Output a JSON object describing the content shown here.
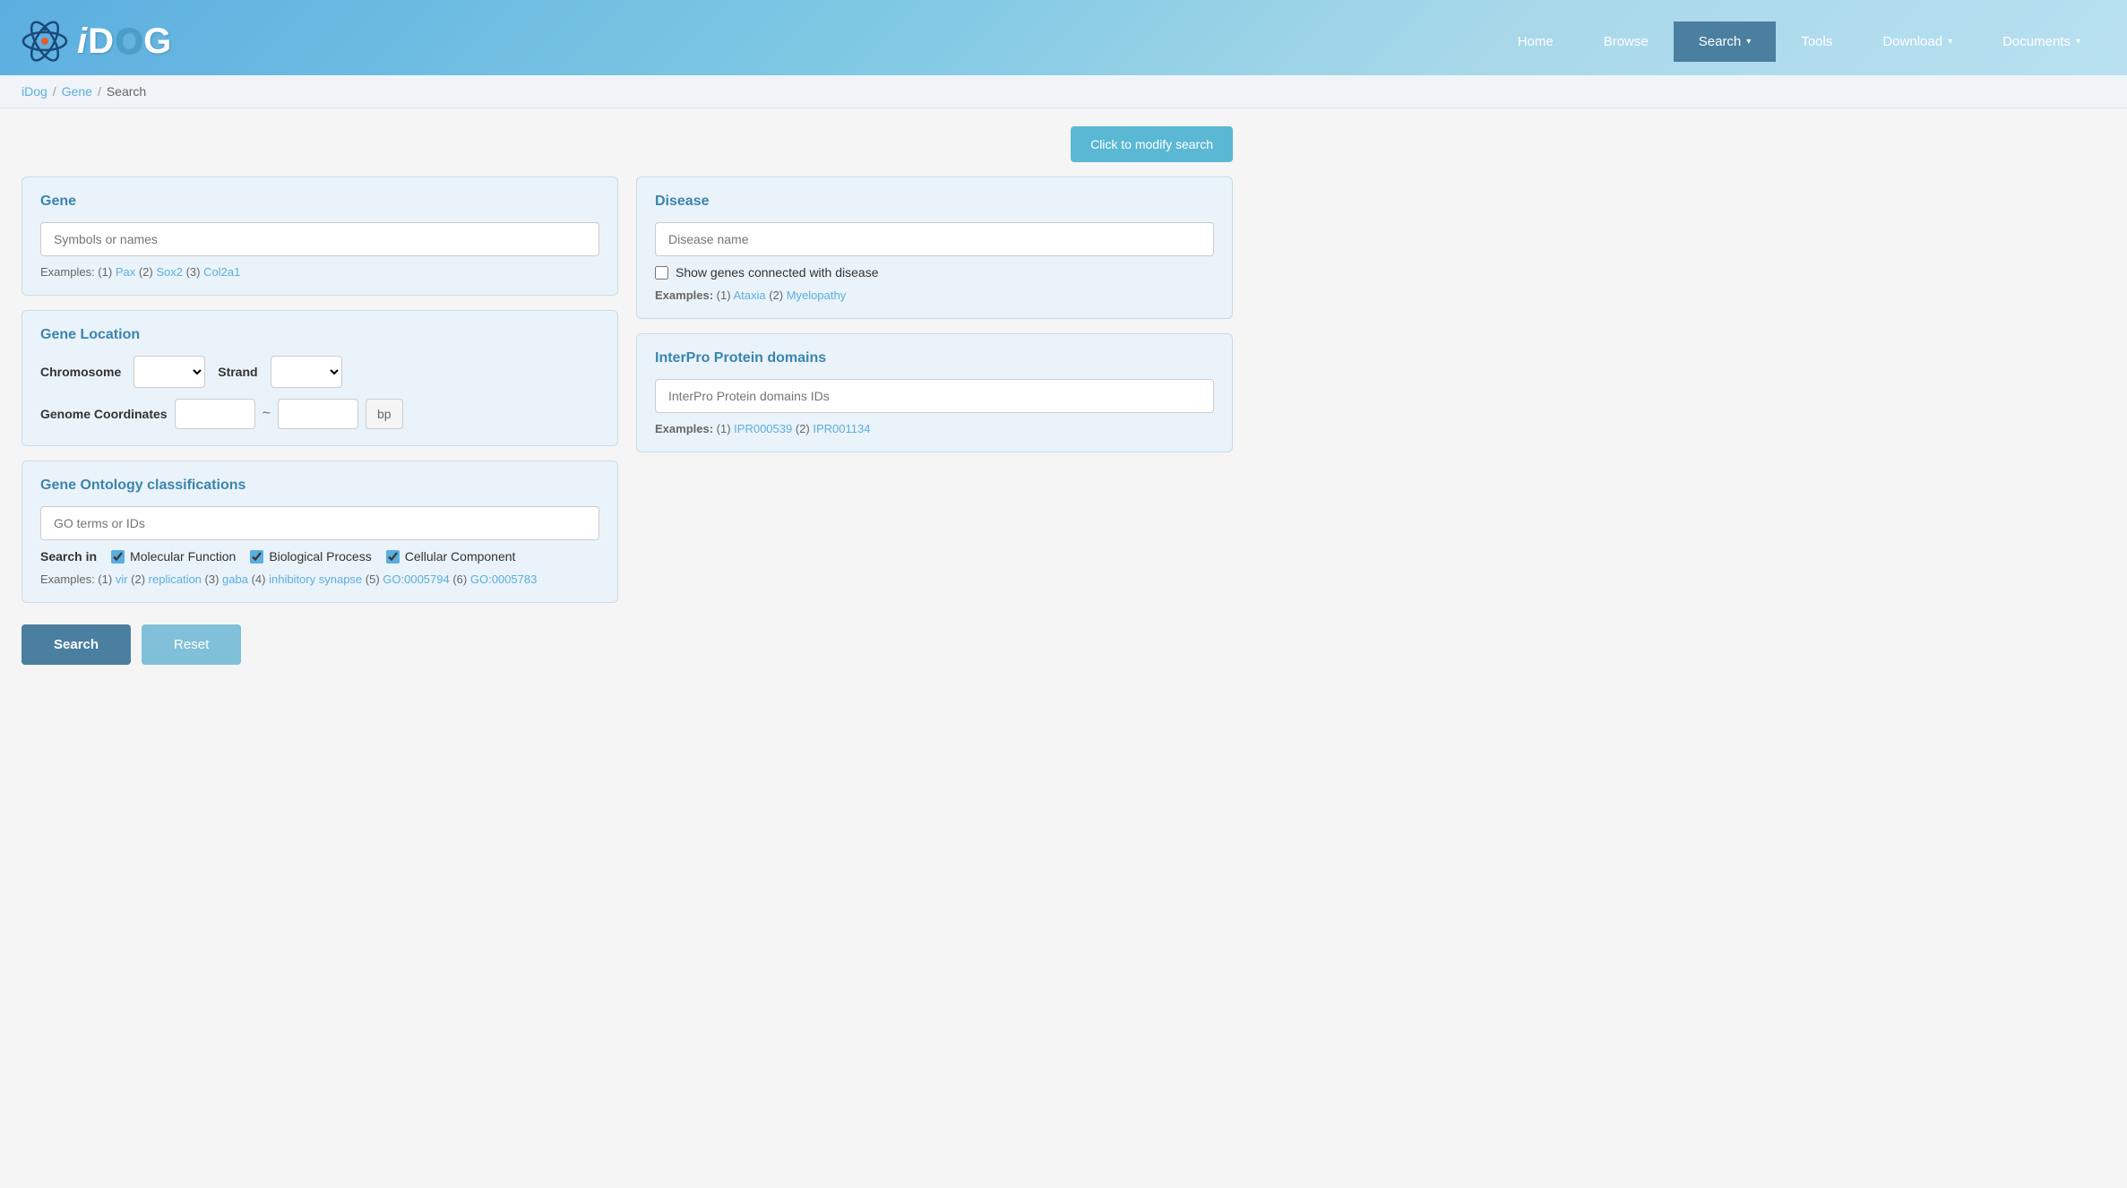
{
  "header": {
    "logo_text": "iDOG",
    "nav_items": [
      {
        "label": "Home",
        "active": false,
        "has_dropdown": false
      },
      {
        "label": "Browse",
        "active": false,
        "has_dropdown": false
      },
      {
        "label": "Search",
        "active": true,
        "has_dropdown": true
      },
      {
        "label": "Tools",
        "active": false,
        "has_dropdown": false
      },
      {
        "label": "Download",
        "active": false,
        "has_dropdown": true
      },
      {
        "label": "Documents",
        "active": false,
        "has_dropdown": true
      }
    ]
  },
  "breadcrumb": {
    "items": [
      {
        "label": "iDog",
        "link": true
      },
      {
        "label": "Gene",
        "link": true
      },
      {
        "label": "Search",
        "link": false
      }
    ]
  },
  "modify_button": "Click to modify search",
  "gene_panel": {
    "title": "Gene",
    "input_placeholder": "Symbols or names",
    "examples_prefix": "Examples: (1)",
    "examples": [
      {
        "label": "Pax",
        "num": "1"
      },
      {
        "label": "Sox2",
        "num": "2"
      },
      {
        "label": "Col2a1",
        "num": "3"
      }
    ]
  },
  "gene_location_panel": {
    "title": "Gene Location",
    "chromosome_label": "Chromosome",
    "strand_label": "Strand",
    "genome_coords_label": "Genome Coordinates",
    "tilde": "~",
    "bp": "bp"
  },
  "gene_ontology_panel": {
    "title": "Gene Ontology classifications",
    "input_placeholder": "GO terms or IDs",
    "search_in_label": "Search in",
    "checkboxes": [
      {
        "label": "Molecular Function",
        "checked": true
      },
      {
        "label": "Biological Process",
        "checked": true
      },
      {
        "label": "Cellular Component",
        "checked": true
      }
    ],
    "examples_prefix": "Examples:",
    "examples": [
      {
        "label": "vir",
        "num": "1"
      },
      {
        "label": "replication",
        "num": "2"
      },
      {
        "label": "gaba",
        "num": "3"
      },
      {
        "label": "inhibitory synapse",
        "num": "4"
      },
      {
        "label": "GO:0005794",
        "num": "5"
      },
      {
        "label": "GO:0005783",
        "num": "6"
      }
    ]
  },
  "disease_panel": {
    "title": "Disease",
    "input_placeholder": "Disease name",
    "checkbox_label": "Show genes connected with disease",
    "examples_prefix": "Examples: (1)",
    "examples": [
      {
        "label": "Ataxia",
        "num": "1"
      },
      {
        "label": "Myelopathy",
        "num": "2"
      }
    ]
  },
  "interpro_panel": {
    "title": "InterPro Protein domains",
    "input_placeholder": "InterPro Protein domains IDs",
    "examples_prefix": "Examples: (1)",
    "examples": [
      {
        "label": "IPR000539",
        "num": "1"
      },
      {
        "label": "IPR001134",
        "num": "2"
      }
    ]
  },
  "buttons": {
    "search": "Search",
    "reset": "Reset"
  }
}
